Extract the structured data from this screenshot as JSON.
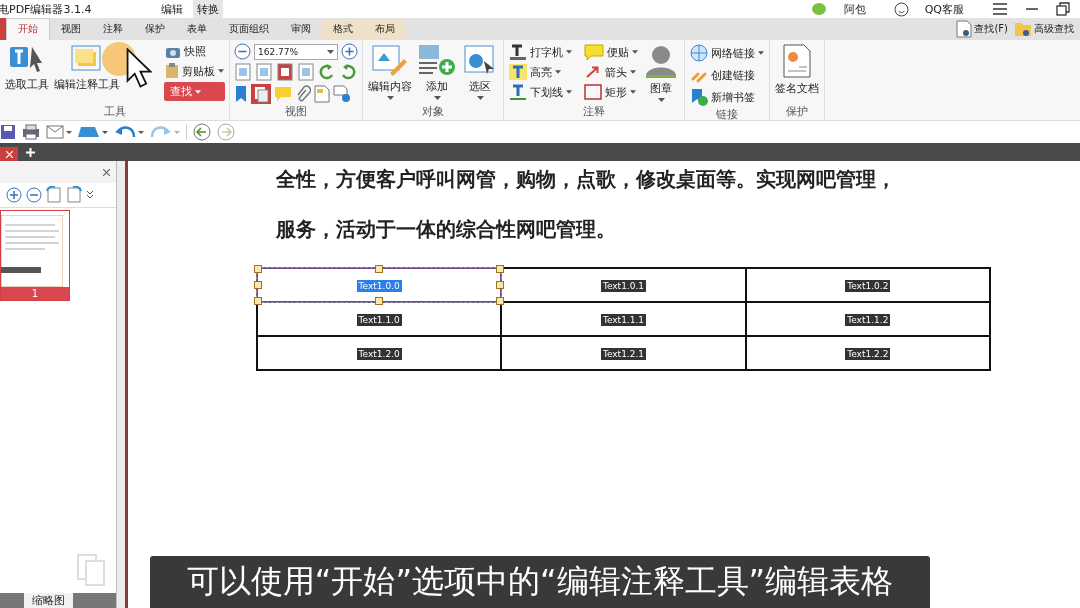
{
  "title_bar": {
    "app_title": "电PDF编辑器3.1.4",
    "context_tabs": [
      {
        "label": "编辑",
        "kind": "plain"
      },
      {
        "label": "转换",
        "kind": "shaded"
      }
    ],
    "user": "阿包",
    "support": "QQ客服"
  },
  "ribbon_tabs": [
    {
      "label": "开始",
      "selected": true
    },
    {
      "label": "视图",
      "selected": false
    },
    {
      "label": "注释",
      "selected": false
    },
    {
      "label": "保护",
      "selected": false
    },
    {
      "label": "表单",
      "selected": false
    },
    {
      "label": "页面组织",
      "selected": false
    },
    {
      "label": "审阅",
      "selected": false
    },
    {
      "label": "格式",
      "selected": false,
      "kind": "context"
    },
    {
      "label": "布局",
      "selected": false,
      "kind": "context"
    }
  ],
  "search_buttons": [
    "查找(F)",
    "高级查找"
  ],
  "ribbon_groups": [
    {
      "label": "工具",
      "items": [
        {
          "kind": "large",
          "label": "选取工具",
          "dropdown": false
        },
        {
          "kind": "large",
          "label": "编辑注释工具",
          "dropdown": false
        },
        {
          "kind": "small",
          "label": "快照",
          "dropdown": false
        },
        {
          "kind": "small",
          "label": "剪贴板",
          "dropdown": true
        },
        {
          "kind": "accent",
          "label": "查找",
          "dropdown": true
        }
      ]
    },
    {
      "label": "视图",
      "zoom": "162.77%"
    },
    {
      "label": "对象",
      "items": [
        {
          "kind": "large",
          "label": "编辑内容",
          "dropdown": true
        },
        {
          "kind": "large",
          "label": "添加",
          "dropdown": true
        },
        {
          "kind": "large",
          "label": "选区",
          "dropdown": true
        }
      ]
    },
    {
      "label": "注释",
      "items": [
        {
          "kind": "small",
          "label": "打字机",
          "dropdown": true
        },
        {
          "kind": "small",
          "label": "便贴",
          "dropdown": true
        },
        {
          "kind": "small",
          "label": "高亮",
          "dropdown": true
        },
        {
          "kind": "small",
          "label": "箭头",
          "dropdown": true
        },
        {
          "kind": "small",
          "label": "下划线",
          "dropdown": true
        },
        {
          "kind": "small",
          "label": "矩形",
          "dropdown": true
        },
        {
          "kind": "large",
          "label": "图章",
          "dropdown": true
        }
      ]
    },
    {
      "label": "链接",
      "items": [
        {
          "kind": "small",
          "label": "网络链接",
          "dropdown": true
        },
        {
          "kind": "small",
          "label": "创建链接",
          "dropdown": false
        },
        {
          "kind": "small",
          "label": "新增书签",
          "dropdown": false
        }
      ]
    },
    {
      "label": "保护",
      "items": [
        {
          "kind": "large",
          "label": "签名文档",
          "dropdown": false
        }
      ]
    }
  ],
  "thumbnail_panel": {
    "page_number": "1",
    "bottom_tab": "缩略图"
  },
  "document": {
    "lines": [
      "全性，方便客户呼叫网管，购物，点歌，修改桌面等。实现网吧管理，",
      "服务，活动于一体的综合性网吧管理。"
    ],
    "table": [
      [
        {
          "text": "Text1.0.0",
          "selected": true
        },
        {
          "text": "Text1.0.1",
          "selected": false
        },
        {
          "text": "Text1.0.2",
          "selected": false
        }
      ],
      [
        {
          "text": "Text1.1.0",
          "selected": false
        },
        {
          "text": "Text1.1.1",
          "selected": false
        },
        {
          "text": "Text1.1.2",
          "selected": false
        }
      ],
      [
        {
          "text": "Text1.2.0",
          "selected": false
        },
        {
          "text": "Text1.2.1",
          "selected": false
        },
        {
          "text": "Text1.2.2",
          "selected": false
        }
      ]
    ]
  },
  "subtitle": "可以使用“开始”选项中的“编辑注释工具”编辑表格"
}
